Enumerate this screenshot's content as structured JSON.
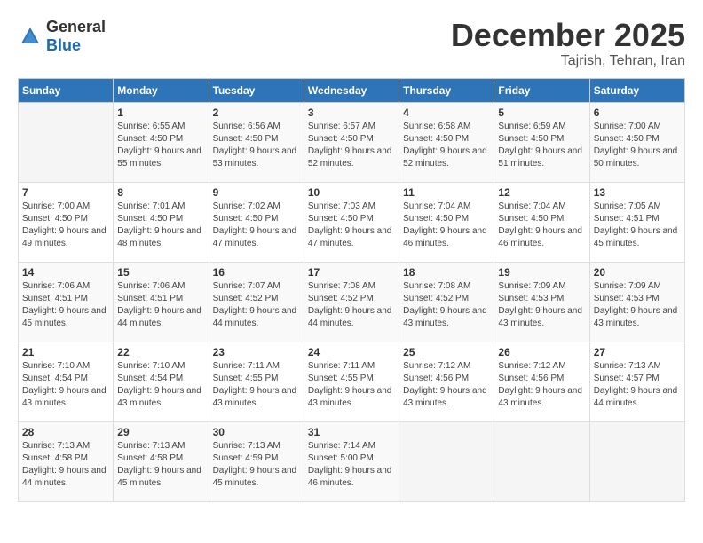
{
  "logo": {
    "general": "General",
    "blue": "Blue"
  },
  "title": {
    "month": "December 2025",
    "location": "Tajrish, Tehran, Iran"
  },
  "headers": [
    "Sunday",
    "Monday",
    "Tuesday",
    "Wednesday",
    "Thursday",
    "Friday",
    "Saturday"
  ],
  "weeks": [
    [
      {
        "day": "",
        "sunrise": "",
        "sunset": "",
        "daylight": ""
      },
      {
        "day": "1",
        "sunrise": "Sunrise: 6:55 AM",
        "sunset": "Sunset: 4:50 PM",
        "daylight": "Daylight: 9 hours and 55 minutes."
      },
      {
        "day": "2",
        "sunrise": "Sunrise: 6:56 AM",
        "sunset": "Sunset: 4:50 PM",
        "daylight": "Daylight: 9 hours and 53 minutes."
      },
      {
        "day": "3",
        "sunrise": "Sunrise: 6:57 AM",
        "sunset": "Sunset: 4:50 PM",
        "daylight": "Daylight: 9 hours and 52 minutes."
      },
      {
        "day": "4",
        "sunrise": "Sunrise: 6:58 AM",
        "sunset": "Sunset: 4:50 PM",
        "daylight": "Daylight: 9 hours and 52 minutes."
      },
      {
        "day": "5",
        "sunrise": "Sunrise: 6:59 AM",
        "sunset": "Sunset: 4:50 PM",
        "daylight": "Daylight: 9 hours and 51 minutes."
      },
      {
        "day": "6",
        "sunrise": "Sunrise: 7:00 AM",
        "sunset": "Sunset: 4:50 PM",
        "daylight": "Daylight: 9 hours and 50 minutes."
      }
    ],
    [
      {
        "day": "7",
        "sunrise": "Sunrise: 7:00 AM",
        "sunset": "Sunset: 4:50 PM",
        "daylight": "Daylight: 9 hours and 49 minutes."
      },
      {
        "day": "8",
        "sunrise": "Sunrise: 7:01 AM",
        "sunset": "Sunset: 4:50 PM",
        "daylight": "Daylight: 9 hours and 48 minutes."
      },
      {
        "day": "9",
        "sunrise": "Sunrise: 7:02 AM",
        "sunset": "Sunset: 4:50 PM",
        "daylight": "Daylight: 9 hours and 47 minutes."
      },
      {
        "day": "10",
        "sunrise": "Sunrise: 7:03 AM",
        "sunset": "Sunset: 4:50 PM",
        "daylight": "Daylight: 9 hours and 47 minutes."
      },
      {
        "day": "11",
        "sunrise": "Sunrise: 7:04 AM",
        "sunset": "Sunset: 4:50 PM",
        "daylight": "Daylight: 9 hours and 46 minutes."
      },
      {
        "day": "12",
        "sunrise": "Sunrise: 7:04 AM",
        "sunset": "Sunset: 4:50 PM",
        "daylight": "Daylight: 9 hours and 46 minutes."
      },
      {
        "day": "13",
        "sunrise": "Sunrise: 7:05 AM",
        "sunset": "Sunset: 4:51 PM",
        "daylight": "Daylight: 9 hours and 45 minutes."
      }
    ],
    [
      {
        "day": "14",
        "sunrise": "Sunrise: 7:06 AM",
        "sunset": "Sunset: 4:51 PM",
        "daylight": "Daylight: 9 hours and 45 minutes."
      },
      {
        "day": "15",
        "sunrise": "Sunrise: 7:06 AM",
        "sunset": "Sunset: 4:51 PM",
        "daylight": "Daylight: 9 hours and 44 minutes."
      },
      {
        "day": "16",
        "sunrise": "Sunrise: 7:07 AM",
        "sunset": "Sunset: 4:52 PM",
        "daylight": "Daylight: 9 hours and 44 minutes."
      },
      {
        "day": "17",
        "sunrise": "Sunrise: 7:08 AM",
        "sunset": "Sunset: 4:52 PM",
        "daylight": "Daylight: 9 hours and 44 minutes."
      },
      {
        "day": "18",
        "sunrise": "Sunrise: 7:08 AM",
        "sunset": "Sunset: 4:52 PM",
        "daylight": "Daylight: 9 hours and 43 minutes."
      },
      {
        "day": "19",
        "sunrise": "Sunrise: 7:09 AM",
        "sunset": "Sunset: 4:53 PM",
        "daylight": "Daylight: 9 hours and 43 minutes."
      },
      {
        "day": "20",
        "sunrise": "Sunrise: 7:09 AM",
        "sunset": "Sunset: 4:53 PM",
        "daylight": "Daylight: 9 hours and 43 minutes."
      }
    ],
    [
      {
        "day": "21",
        "sunrise": "Sunrise: 7:10 AM",
        "sunset": "Sunset: 4:54 PM",
        "daylight": "Daylight: 9 hours and 43 minutes."
      },
      {
        "day": "22",
        "sunrise": "Sunrise: 7:10 AM",
        "sunset": "Sunset: 4:54 PM",
        "daylight": "Daylight: 9 hours and 43 minutes."
      },
      {
        "day": "23",
        "sunrise": "Sunrise: 7:11 AM",
        "sunset": "Sunset: 4:55 PM",
        "daylight": "Daylight: 9 hours and 43 minutes."
      },
      {
        "day": "24",
        "sunrise": "Sunrise: 7:11 AM",
        "sunset": "Sunset: 4:55 PM",
        "daylight": "Daylight: 9 hours and 43 minutes."
      },
      {
        "day": "25",
        "sunrise": "Sunrise: 7:12 AM",
        "sunset": "Sunset: 4:56 PM",
        "daylight": "Daylight: 9 hours and 43 minutes."
      },
      {
        "day": "26",
        "sunrise": "Sunrise: 7:12 AM",
        "sunset": "Sunset: 4:56 PM",
        "daylight": "Daylight: 9 hours and 43 minutes."
      },
      {
        "day": "27",
        "sunrise": "Sunrise: 7:13 AM",
        "sunset": "Sunset: 4:57 PM",
        "daylight": "Daylight: 9 hours and 44 minutes."
      }
    ],
    [
      {
        "day": "28",
        "sunrise": "Sunrise: 7:13 AM",
        "sunset": "Sunset: 4:58 PM",
        "daylight": "Daylight: 9 hours and 44 minutes."
      },
      {
        "day": "29",
        "sunrise": "Sunrise: 7:13 AM",
        "sunset": "Sunset: 4:58 PM",
        "daylight": "Daylight: 9 hours and 45 minutes."
      },
      {
        "day": "30",
        "sunrise": "Sunrise: 7:13 AM",
        "sunset": "Sunset: 4:59 PM",
        "daylight": "Daylight: 9 hours and 45 minutes."
      },
      {
        "day": "31",
        "sunrise": "Sunrise: 7:14 AM",
        "sunset": "Sunset: 5:00 PM",
        "daylight": "Daylight: 9 hours and 46 minutes."
      },
      {
        "day": "",
        "sunrise": "",
        "sunset": "",
        "daylight": ""
      },
      {
        "day": "",
        "sunrise": "",
        "sunset": "",
        "daylight": ""
      },
      {
        "day": "",
        "sunrise": "",
        "sunset": "",
        "daylight": ""
      }
    ]
  ]
}
